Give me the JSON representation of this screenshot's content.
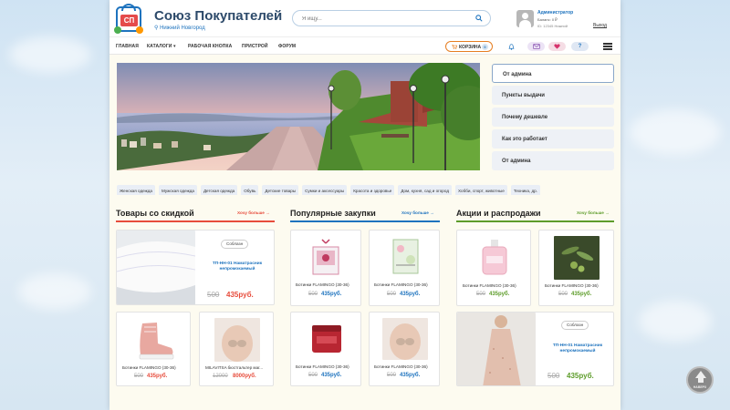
{
  "header": {
    "brand_badge": "СП",
    "brand_name": "Союз Покупателей",
    "city": "Нижний Новгород",
    "search_placeholder": "Я ищу...",
    "user_name": "Администратор",
    "user_balance": "Баланс: 0 ₽",
    "user_id": "ID: 12345 Нижний",
    "logout": "Выход"
  },
  "nav": {
    "items": [
      "ГЛАВНАЯ",
      "КАТАЛОГИ",
      "РАБОЧАЯ КНОПКА",
      "ПРИСТРОЙ",
      "ФОРУМ"
    ],
    "cart_label": "КОРЗИНА",
    "cart_count": "0"
  },
  "side_menu": [
    "От админа",
    "Пункты выдачи",
    "Почему дешевле",
    "Как это работает",
    "От админа"
  ],
  "categories": [
    "Женская одежда",
    "Мужская одежда",
    "Детская одежда",
    "Обувь",
    "Детские товары",
    "Сумки и аксессуары",
    "Красота и здоровье",
    "Дом, кухня, сад и огород",
    "Хобби, спорт, животные",
    "Техника, др."
  ],
  "sections": {
    "discount": {
      "title": "Товары со скидкой",
      "more": "Хочу больше →"
    },
    "popular": {
      "title": "Популярные закупки",
      "more": "Хочу больше →"
    },
    "promo": {
      "title": "Акции и распродажи",
      "more": "Хочу больше →"
    }
  },
  "discount_cards": [
    {
      "stamp": "Соблазн",
      "link": "ТП-НН-01 Наматрасник непромокаемый",
      "old": "500",
      "new": "435руб."
    },
    {
      "name": "Ботинки FLAMINGO (30-36)",
      "old": "500",
      "new": "435руб."
    },
    {
      "name": "MILAVITSA бюстгальтер маг...",
      "old": "12000",
      "new": "8000руб."
    }
  ],
  "popular_cards": [
    {
      "name": "Ботинки FLAMINGO (30-36)",
      "old": "500",
      "new": "435руб."
    },
    {
      "name": "Ботинки FLAMINGO (30-36)",
      "old": "500",
      "new": "435руб."
    },
    {
      "name": "Ботинки FLAMINGO (30-36)",
      "old": "500",
      "new": "435руб."
    },
    {
      "name": "Ботинки FLAMINGO (30-36)",
      "old": "500",
      "new": "435руб."
    }
  ],
  "promo_cards": [
    {
      "name": "Ботинки FLAMINGO (30-36)",
      "old": "500",
      "new": "435руб."
    },
    {
      "name": "Ботинки FLAMINGO (30-36)",
      "old": "500",
      "new": "435руб."
    },
    {
      "stamp": "Соблазн",
      "link": "ТП-НН-01 Наматрасник непромокаемый",
      "old": "500",
      "new": "435руб."
    }
  ],
  "scroll_up_label": "НАВЕРХ",
  "colors": {
    "discount": "#e74c3c",
    "popular": "#1e73be",
    "promo": "#5d9c2a",
    "accent_blue": "#1e73be"
  }
}
